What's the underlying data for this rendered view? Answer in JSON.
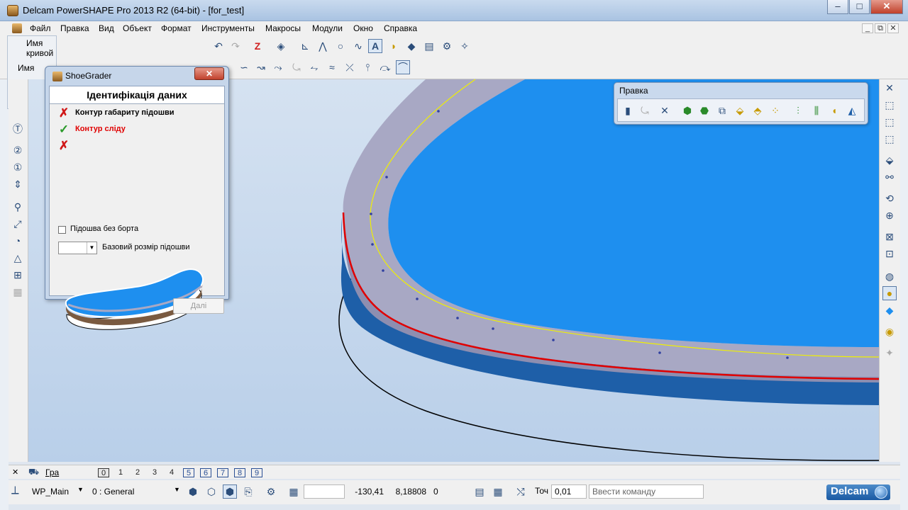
{
  "window": {
    "title": "Delcam PowerSHAPE Pro 2013 R2 (64-bit) - [for_test]",
    "minimize": "–",
    "maximize": "□",
    "close": "✕"
  },
  "menu": [
    "Файл",
    "Правка",
    "Вид",
    "Объект",
    "Формат",
    "Инструменты",
    "Макросы",
    "Модули",
    "Окно",
    "Справка"
  ],
  "mdi_controls": [
    "_",
    "⧉",
    "✕"
  ],
  "curve_panel": {
    "title": "Имя кривой",
    "name_label": "Имя"
  },
  "dialog": {
    "title": "ShoeGrader",
    "close": "✕",
    "heading": "Ідентифікація даних",
    "items": [
      {
        "label": "Контур габариту підошви",
        "status": "error",
        "color": "#000000"
      },
      {
        "label": "Контур сліду",
        "status": "ok",
        "color": "#e00000"
      },
      {
        "label": "",
        "status": "error",
        "color": "#b0b0b0"
      }
    ],
    "checkbox_label": "Підошва без борта",
    "checkbox_checked": false,
    "combo_value": "",
    "combo_label": "Базовий розмір підошви",
    "next_button": "Далі"
  },
  "edit_panel": {
    "title": "Правка"
  },
  "levels": {
    "gra_label": "Гра",
    "items": [
      "0",
      "1",
      "2",
      "3",
      "4",
      "5",
      "6",
      "7",
      "8",
      "9"
    ]
  },
  "status": {
    "workplane": "WP_Main",
    "level": "0  : General",
    "x": "-130,41",
    "y": "8,18808",
    "z": "0",
    "tol_label": "Точ",
    "tol_value": "0,01",
    "command_placeholder": "Ввести команду",
    "brand": "Delcam"
  },
  "colors": {
    "model_blue": "#1e8fef",
    "contour_red": "#e00000",
    "contour_yellow": "#f0f000",
    "wall_grey": "#a8a8c4"
  }
}
